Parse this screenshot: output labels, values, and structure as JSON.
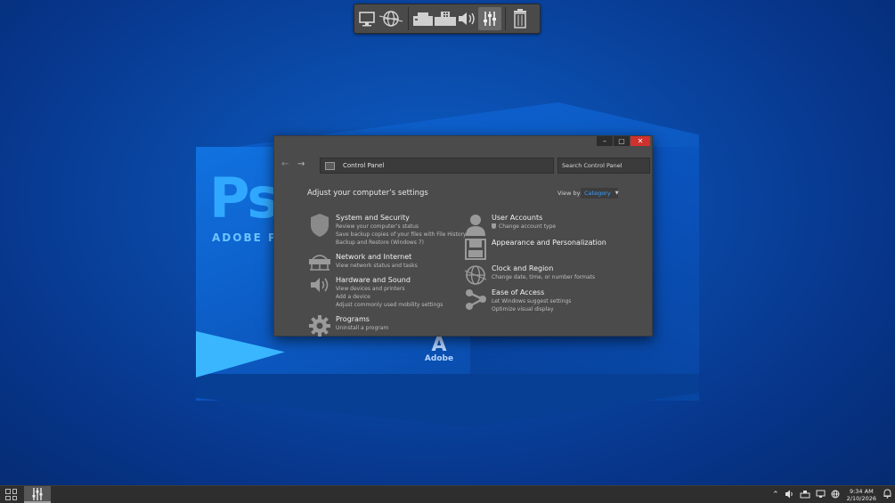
{
  "wallpaper": {
    "logo_text": "Ps",
    "subtitle": "ADOBE PHO",
    "brand": "Adobe"
  },
  "top_toolbar": {
    "icons": [
      "monitor-icon",
      "globe-network-icon",
      "devices-icon",
      "keyboard-icon",
      "speaker-icon",
      "mixer-sliders-icon",
      "recycle-bin-icon"
    ]
  },
  "window": {
    "controls": {
      "minimize": "–",
      "maximize": "▢",
      "close": "✕"
    },
    "address": "Control Panel",
    "search_placeholder": "Search Control Panel",
    "heading": "Adjust your computer’s settings",
    "view_by_label": "View by:",
    "view_by_value": "Category",
    "left_categories": [
      {
        "title": "System and Security",
        "links": [
          "Review your computer’s status",
          "Save backup copies of your files with File History",
          "Backup and Restore (Windows 7)"
        ]
      },
      {
        "title": "Network and Internet",
        "links": [
          "View network status and tasks"
        ]
      },
      {
        "title": "Hardware and Sound",
        "links": [
          "View devices and printers",
          "Add a device",
          "Adjust commonly used mobility settings"
        ]
      },
      {
        "title": "Programs",
        "links": [
          "Uninstall a program"
        ]
      }
    ],
    "right_categories": [
      {
        "title": "User Accounts",
        "links": [
          "Change account type"
        ]
      },
      {
        "title": "Appearance and Personalization",
        "links": []
      },
      {
        "title": "Clock and Region",
        "links": [
          "Change date, time, or number formats"
        ]
      },
      {
        "title": "Ease of Access",
        "links": [
          "Let Windows suggest settings",
          "Optimize visual display"
        ]
      }
    ]
  },
  "taskbar": {
    "time": "9:34 AM",
    "date": "2/10/2026"
  },
  "colors": {
    "accent_link": "#3a9cff",
    "close_red": "#d0312d",
    "window_bg": "#4b4b4b"
  }
}
